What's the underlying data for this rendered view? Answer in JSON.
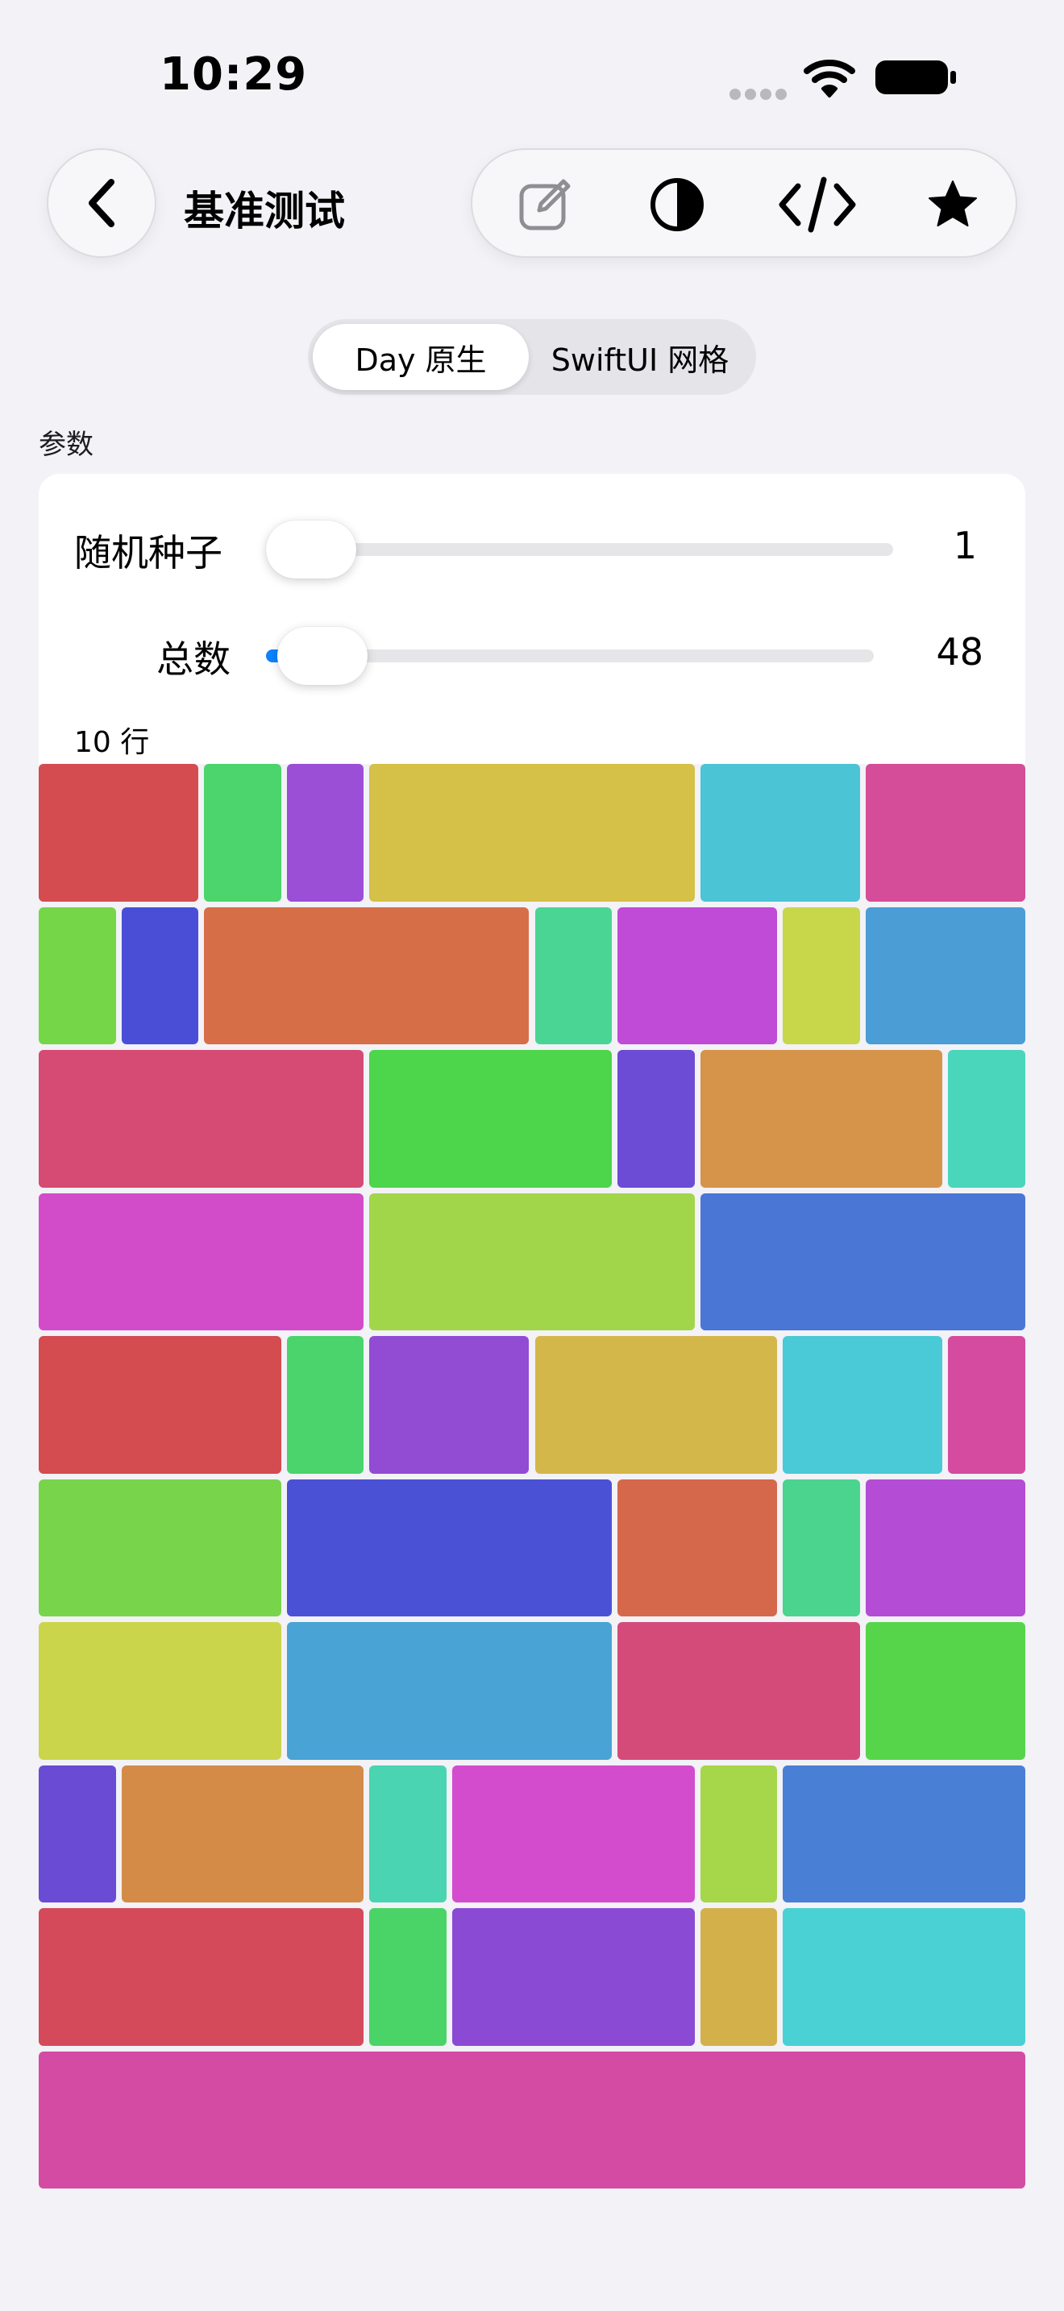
{
  "status_bar": {
    "time": "10:29"
  },
  "nav": {
    "title": "基准测试",
    "toolbar_icons": [
      "edit-icon",
      "contrast-icon",
      "code-icon",
      "star-icon"
    ]
  },
  "segmented": {
    "options": [
      "Day 原生",
      "SwiftUI 网格"
    ],
    "selected": "Day 原生"
  },
  "section_label": "参数",
  "params": [
    {
      "label": "随机种子",
      "value": "1",
      "slider_fraction": 0.0
    },
    {
      "label": "总数",
      "value": "48",
      "slider_fraction": 0.02
    }
  ],
  "rows_label": "10 行",
  "grid": {
    "columns": 12,
    "rows": [
      [
        [
          2,
          "#d44c4f"
        ],
        [
          1,
          "#4cd46d"
        ],
        [
          1,
          "#9b4ed6"
        ],
        [
          4,
          "#d5c048"
        ],
        [
          2,
          "#4bc4d5"
        ],
        [
          2,
          "#d54c98"
        ]
      ],
      [
        [
          1,
          "#75d648"
        ],
        [
          1,
          "#4a4ed7"
        ],
        [
          4,
          "#d66e48"
        ],
        [
          1,
          "#4ad595"
        ],
        [
          2,
          "#c04bd6"
        ],
        [
          1,
          "#c8d64a"
        ],
        [
          2,
          "#4a9dd5"
        ]
      ],
      [
        [
          4,
          "#d54b73"
        ],
        [
          3,
          "#4dd54c"
        ],
        [
          1,
          "#6c4bd5"
        ],
        [
          3,
          "#d5944a"
        ],
        [
          1,
          "#4ad6bb"
        ]
      ],
      [
        [
          4,
          "#d24bc9"
        ],
        [
          4,
          "#a1d64a"
        ],
        [
          4,
          "#4a76d6"
        ]
      ],
      [
        [
          3,
          "#d44b50"
        ],
        [
          1,
          "#4ad46b"
        ],
        [
          2,
          "#924cd4"
        ],
        [
          3,
          "#d4b74a"
        ],
        [
          2,
          "#4ac9d6"
        ],
        [
          1,
          "#d54ba0"
        ]
      ],
      [
        [
          3,
          "#78d54b"
        ],
        [
          4,
          "#4b51d5"
        ],
        [
          2,
          "#d5684a"
        ],
        [
          1,
          "#4ad48d"
        ],
        [
          2,
          "#b44cd5"
        ]
      ],
      [
        [
          3,
          "#cbd54b"
        ],
        [
          4,
          "#4aa3d5"
        ],
        [
          3,
          "#d44b7a"
        ],
        [
          2,
          "#57d54a"
        ]
      ],
      [
        [
          1,
          "#6a4bd4"
        ],
        [
          3,
          "#d48b48"
        ],
        [
          1,
          "#4ad4b1"
        ],
        [
          3,
          "#d34cce"
        ],
        [
          1,
          "#a6d64a"
        ],
        [
          3,
          "#4a7fd6"
        ]
      ],
      [
        [
          4,
          "#d44a5b"
        ],
        [
          1,
          "#4ad468"
        ],
        [
          3,
          "#8b4ad4"
        ],
        [
          1,
          "#d4b04a"
        ],
        [
          3,
          "#4ad1d4"
        ]
      ],
      [
        [
          12,
          "#d44ba4"
        ]
      ]
    ]
  }
}
